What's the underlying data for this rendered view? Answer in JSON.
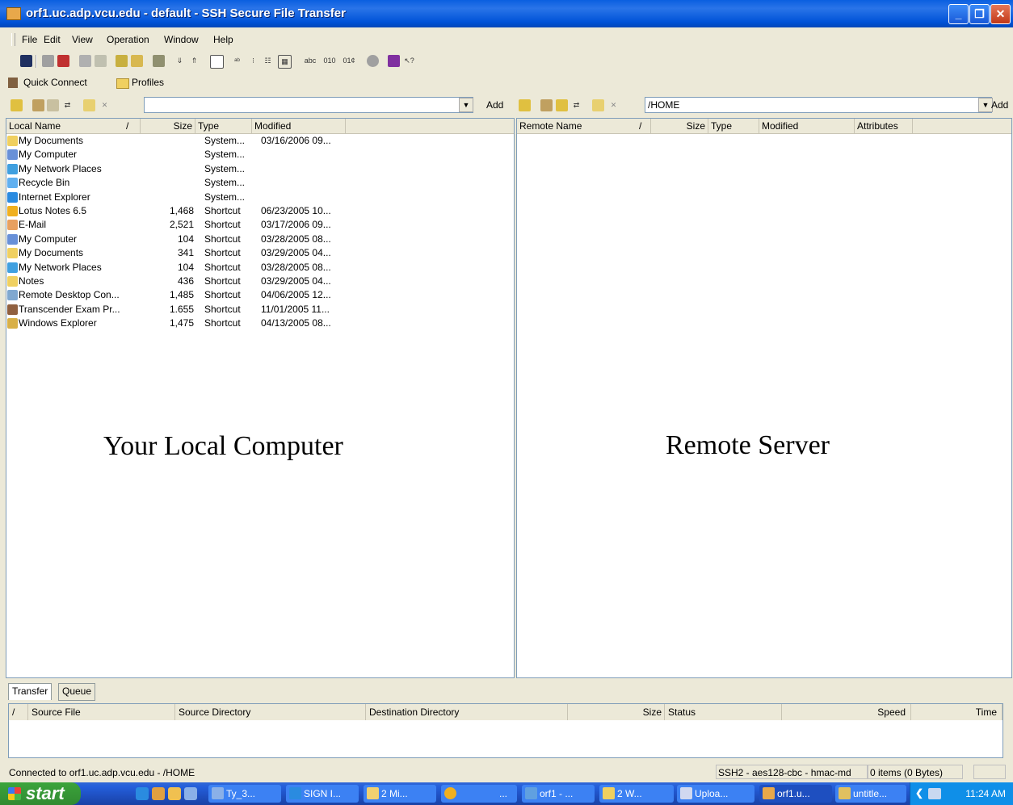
{
  "window": {
    "title": "orf1.uc.adp.vcu.edu - default - SSH Secure File Transfer"
  },
  "menu": [
    "File",
    "Edit",
    "View",
    "Operation",
    "Window",
    "Help"
  ],
  "quick_connect": {
    "quick_connect_label": "Quick Connect",
    "profiles_label": "Profiles"
  },
  "local": {
    "path": "",
    "add_label": "Add",
    "headers": {
      "name": "Local Name",
      "sort": "/",
      "size": "Size",
      "type": "Type",
      "modified": "Modified"
    },
    "overlay": "Your Local Computer",
    "rows": [
      {
        "name": "My Documents",
        "size": "",
        "type": "System...",
        "modified": "03/16/2006 09...",
        "icon": "folder-docs-icon"
      },
      {
        "name": "My Computer",
        "size": "",
        "type": "System...",
        "modified": "",
        "icon": "computer-icon"
      },
      {
        "name": "My Network Places",
        "size": "",
        "type": "System...",
        "modified": "",
        "icon": "network-icon"
      },
      {
        "name": "Recycle Bin",
        "size": "",
        "type": "System...",
        "modified": "",
        "icon": "recycle-bin-icon"
      },
      {
        "name": "Internet Explorer",
        "size": "",
        "type": "System...",
        "modified": "",
        "icon": "ie-icon"
      },
      {
        "name": "Lotus Notes 6.5",
        "size": "1,468",
        "type": "Shortcut",
        "modified": "06/23/2005 10...",
        "icon": "lotus-icon"
      },
      {
        "name": "E-Mail",
        "size": "2,521",
        "type": "Shortcut",
        "modified": "03/17/2006 09...",
        "icon": "email-icon"
      },
      {
        "name": "My Computer",
        "size": "104",
        "type": "Shortcut",
        "modified": "03/28/2005 08...",
        "icon": "computer-icon"
      },
      {
        "name": "My Documents",
        "size": "341",
        "type": "Shortcut",
        "modified": "03/29/2005 04...",
        "icon": "folder-docs-icon"
      },
      {
        "name": "My Network Places",
        "size": "104",
        "type": "Shortcut",
        "modified": "03/28/2005 08...",
        "icon": "network-icon"
      },
      {
        "name": "Notes",
        "size": "436",
        "type": "Shortcut",
        "modified": "03/29/2005 04...",
        "icon": "folder-icon"
      },
      {
        "name": "Remote Desktop Con...",
        "size": "1,485",
        "type": "Shortcut",
        "modified": "04/06/2005 12...",
        "icon": "remote-desktop-icon"
      },
      {
        "name": "Transcender Exam Pr...",
        "size": "1.655",
        "type": "Shortcut",
        "modified": "11/01/2005 11...",
        "icon": "exam-icon"
      },
      {
        "name": "Windows Explorer",
        "size": "1,475",
        "type": "Shortcut",
        "modified": "04/13/2005 08...",
        "icon": "explorer-icon"
      }
    ]
  },
  "remote": {
    "path": "/HOME",
    "add_label": "Add",
    "headers": {
      "name": "Remote Name",
      "sort": "/",
      "size": "Size",
      "type": "Type",
      "modified": "Modified",
      "attributes": "Attributes"
    },
    "overlay": "Remote Server"
  },
  "transfer": {
    "tabs": [
      "Transfer",
      "Queue"
    ],
    "headers": {
      "sort": "/",
      "source_file": "Source File",
      "source_dir": "Source Directory",
      "dest_dir": "Destination Directory",
      "size": "Size",
      "status": "Status",
      "speed": "Speed",
      "time": "Time"
    }
  },
  "status": {
    "connection": "Connected to orf1.uc.adp.vcu.edu - /HOME",
    "cipher": "SSH2 - aes128-cbc - hmac-md",
    "items": "0 items (0 Bytes)"
  },
  "taskbar": {
    "start": "start",
    "tasks": [
      "Ty_3...",
      "SIGN I...",
      "2 Mi...",
      "...",
      "orf1 - ...",
      "2 W...",
      "Uploa...",
      "orf1.u...",
      "untitle..."
    ],
    "clock": "11:24 AM"
  },
  "colors": {
    "title_bar": "#0a5fe0",
    "face": "#ece9d8",
    "taskbar": "#245edb",
    "start": "#3ba43b"
  }
}
